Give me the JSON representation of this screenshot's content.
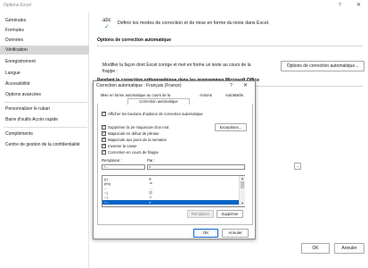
{
  "window": {
    "title": "Options Excel",
    "help": "?",
    "close": "✕"
  },
  "sidebar": {
    "items": [
      {
        "label": "Générales"
      },
      {
        "label": "Formules"
      },
      {
        "label": "Données"
      },
      {
        "label": "Vérification"
      },
      {
        "label": "Enregistrement"
      },
      {
        "label": "Langue"
      },
      {
        "label": "Accessibilité"
      },
      {
        "label": "Options avancées"
      },
      {
        "label": "Personnaliser le ruban"
      },
      {
        "label": "Barre d'outils Accès rapide"
      },
      {
        "label": "Compléments"
      },
      {
        "label": "Centre de gestion de la confidentialité"
      }
    ],
    "selected": "Vérification"
  },
  "main": {
    "icon_text": "abc",
    "description": "Définir les modes de correction et de mise en forme du texte dans Excel.",
    "section1_title": "Options de correction automatique",
    "modify_text": "Modifier la façon dont Excel corrige et met en forme un texte au cours de la frappe :",
    "autocorrect_button": "Options de correction automatique...",
    "section2_title": "Pendant la correction orthographique dans les programmes Microsoft Office",
    "ok": "OK",
    "cancel": "Annuler",
    "partial_r": "r",
    "dropdown_glyph": "⌄"
  },
  "dialog": {
    "title": "Correction automatique : Français (France)",
    "help": "?",
    "close": "✕",
    "tabs": [
      {
        "label": "Mise en forme automatique au cours de la frappe"
      },
      {
        "label": "Actions"
      },
      {
        "label": "AutoMaths"
      },
      {
        "label": "Correction automatique"
      }
    ],
    "show_buttons": "Afficher les boutons d'options de correction automatique",
    "checks": [
      {
        "label": "Supprimer la 2e majuscule d'un mot",
        "checked": true
      },
      {
        "label": "Majuscule en début de phrase",
        "checked": true
      },
      {
        "label": "Majuscule aux jours de la semaine",
        "checked": true
      },
      {
        "label": "Inverser la casse",
        "checked": true
      },
      {
        "label": "Correction en cours de frappe",
        "checked": true
      }
    ],
    "exceptions_button": "Exceptions...",
    "replace_label": "Remplacer :",
    "by_label": "Par :",
    "replace_value": "+--",
    "by_value": "±",
    "list": [
      {
        "from": "(r)",
        "to": "®"
      },
      {
        "from": "(tm)",
        "to": "™"
      },
      {
        "from": "...",
        "to": "…"
      },
      {
        "from": ":-(",
        "to": "☹"
      },
      {
        "from": ":-)",
        "to": "☺"
      },
      {
        "from": "+--",
        "to": "±"
      }
    ],
    "replace_button": "Remplacer",
    "delete_button": "Supprimer",
    "ok": "OK",
    "cancel": "Annuler",
    "scroll_up": "▲",
    "scroll_down": "▼"
  },
  "colors": {
    "selection": "#0a64c8",
    "sidebar_selected": "#d6d6d6"
  }
}
